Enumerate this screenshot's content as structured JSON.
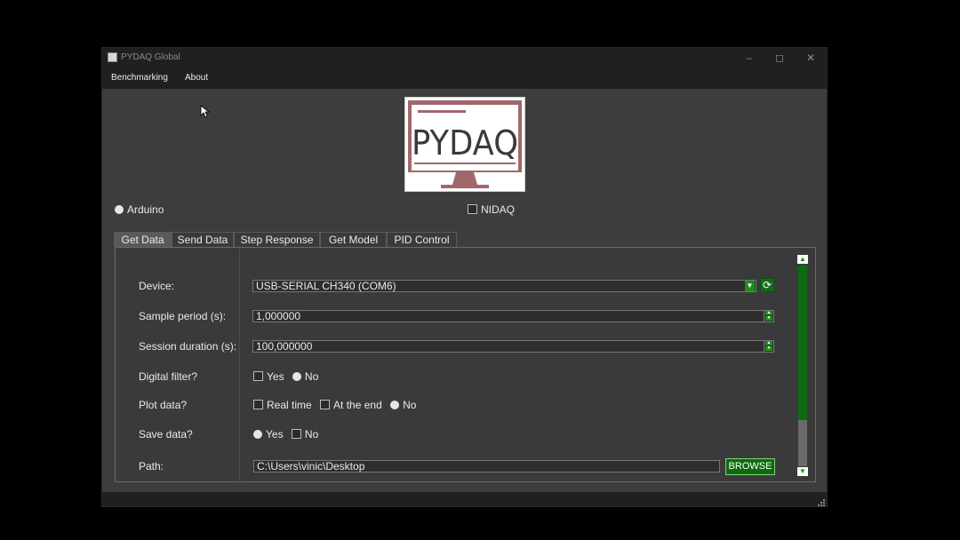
{
  "window": {
    "title": "PYDAQ Global",
    "minimize_icon": "minimize-icon",
    "maximize_icon": "maximize-icon",
    "close_icon": "close-icon"
  },
  "menu": [
    "Benchmarking",
    "About"
  ],
  "logo": {
    "text": "PYDAQ",
    "color": "#a0686a"
  },
  "board": {
    "arduino": "Arduino",
    "nidaq": "NIDAQ"
  },
  "tabs": [
    "Get Data",
    "Send Data",
    "Step Response",
    "Get Model",
    "PID Control"
  ],
  "active_tab": "Get Data",
  "form": {
    "device_label": "Device:",
    "device_value": "USB-SERIAL CH340 (COM6)",
    "sample_label": "Sample period (s):",
    "sample_value": "1,000000",
    "session_label": "Session duration (s):",
    "session_value": "100,000000",
    "filter_label": "Digital filter?",
    "filter_yes": "Yes",
    "filter_no": "No",
    "plot_label": "Plot data?",
    "plot_realtime": "Real time",
    "plot_end": "At the end",
    "plot_no": "No",
    "save_label": "Save data?",
    "save_yes": "Yes",
    "save_no": "No",
    "path_label": "Path:",
    "path_value": "C:\\Users\\vinic\\Desktop",
    "browse": "BROWSE"
  },
  "colors": {
    "accent": "#1a8f1a",
    "background": "#3d3d3d",
    "titlebar": "#202020"
  }
}
